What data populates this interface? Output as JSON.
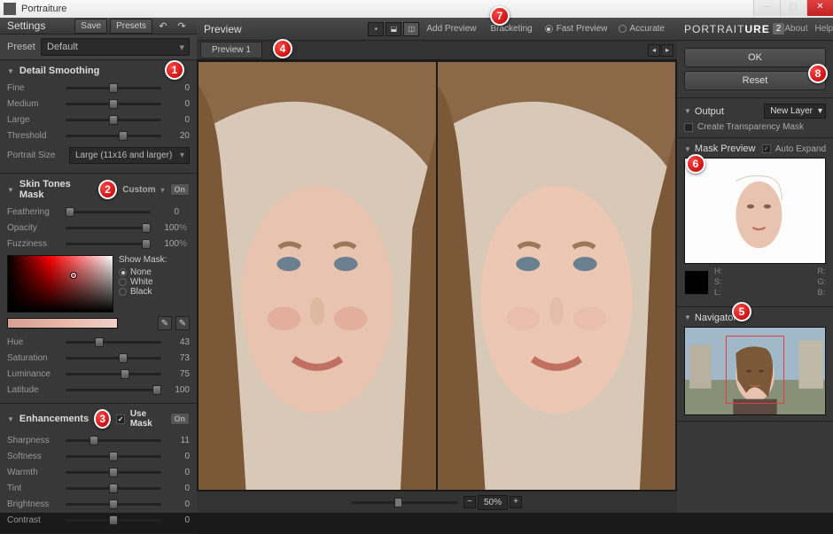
{
  "app": {
    "title": "Portraiture"
  },
  "win_btns": {
    "min": "—",
    "max": "▢",
    "close": "✕"
  },
  "left": {
    "header": "Settings",
    "save": "Save",
    "presets": "Presets",
    "undo": "↶",
    "redo": "↷",
    "preset_lbl": "Preset",
    "preset_val": "Default",
    "detail": {
      "title": "Detail Smoothing",
      "sliders": [
        {
          "label": "Fine",
          "value": "0",
          "pos": 50
        },
        {
          "label": "Medium",
          "value": "0",
          "pos": 50
        },
        {
          "label": "Large",
          "value": "0",
          "pos": 50
        },
        {
          "label": "Threshold",
          "value": "20",
          "pos": 60
        }
      ],
      "portrait_lbl": "Portrait Size",
      "portrait_val": "Large (11x16 and larger)"
    },
    "mask": {
      "title": "Skin Tones Mask",
      "mode": "Custom",
      "on": "On",
      "sliders": [
        {
          "label": "Feathering",
          "value": "0",
          "pct": "",
          "pos": 5
        },
        {
          "label": "Opacity",
          "value": "100",
          "pct": "%",
          "pos": 95
        },
        {
          "label": "Fuzziness",
          "value": "100",
          "pct": "%",
          "pos": 95
        }
      ],
      "showmask_lbl": "Show Mask:",
      "radios": [
        {
          "label": "None",
          "on": true
        },
        {
          "label": "White",
          "on": false
        },
        {
          "label": "Black",
          "on": false
        }
      ],
      "hsl_sliders": [
        {
          "label": "Hue",
          "value": "43",
          "pos": 35
        },
        {
          "label": "Saturation",
          "value": "73",
          "pos": 60
        },
        {
          "label": "Luminance",
          "value": "75",
          "pos": 62
        },
        {
          "label": "Latitude",
          "value": "100",
          "pos": 95
        }
      ]
    },
    "enhance": {
      "title": "Enhancements",
      "usemask": "Use Mask",
      "on": "On",
      "sliders": [
        {
          "label": "Sharpness",
          "value": "11",
          "pos": 30
        },
        {
          "label": "Softness",
          "value": "0",
          "pos": 50
        },
        {
          "label": "Warmth",
          "value": "0",
          "pos": 50
        },
        {
          "label": "Tint",
          "value": "0",
          "pos": 50
        },
        {
          "label": "Brightness",
          "value": "0",
          "pos": 50
        },
        {
          "label": "Contrast",
          "value": "0",
          "pos": 50
        }
      ]
    }
  },
  "center": {
    "header": "Preview",
    "add": "Add Preview",
    "bracket": "Bracketing",
    "fast": "Fast Preview",
    "accurate": "Accurate",
    "tab": "Preview 1",
    "zoom": "50%"
  },
  "right": {
    "brand1": "PORTRAIT",
    "brand2": "URE",
    "version": "2",
    "about": "About",
    "help": "Help",
    "ok": "OK",
    "reset": "Reset",
    "output_lbl": "Output",
    "output_val": "New Layer",
    "transp": "Create Transparency Mask",
    "maskprev": "Mask Preview",
    "autoexp": "Auto Expand",
    "hsl": {
      "h": "H:",
      "s": "S:",
      "l": "L:",
      "r": "R:",
      "g": "G:",
      "b": "B:"
    },
    "nav": "Navigator"
  },
  "callouts": {
    "1": "1",
    "2": "2",
    "3": "3",
    "4": "4",
    "5": "5",
    "6": "6",
    "7": "7",
    "8": "8"
  }
}
